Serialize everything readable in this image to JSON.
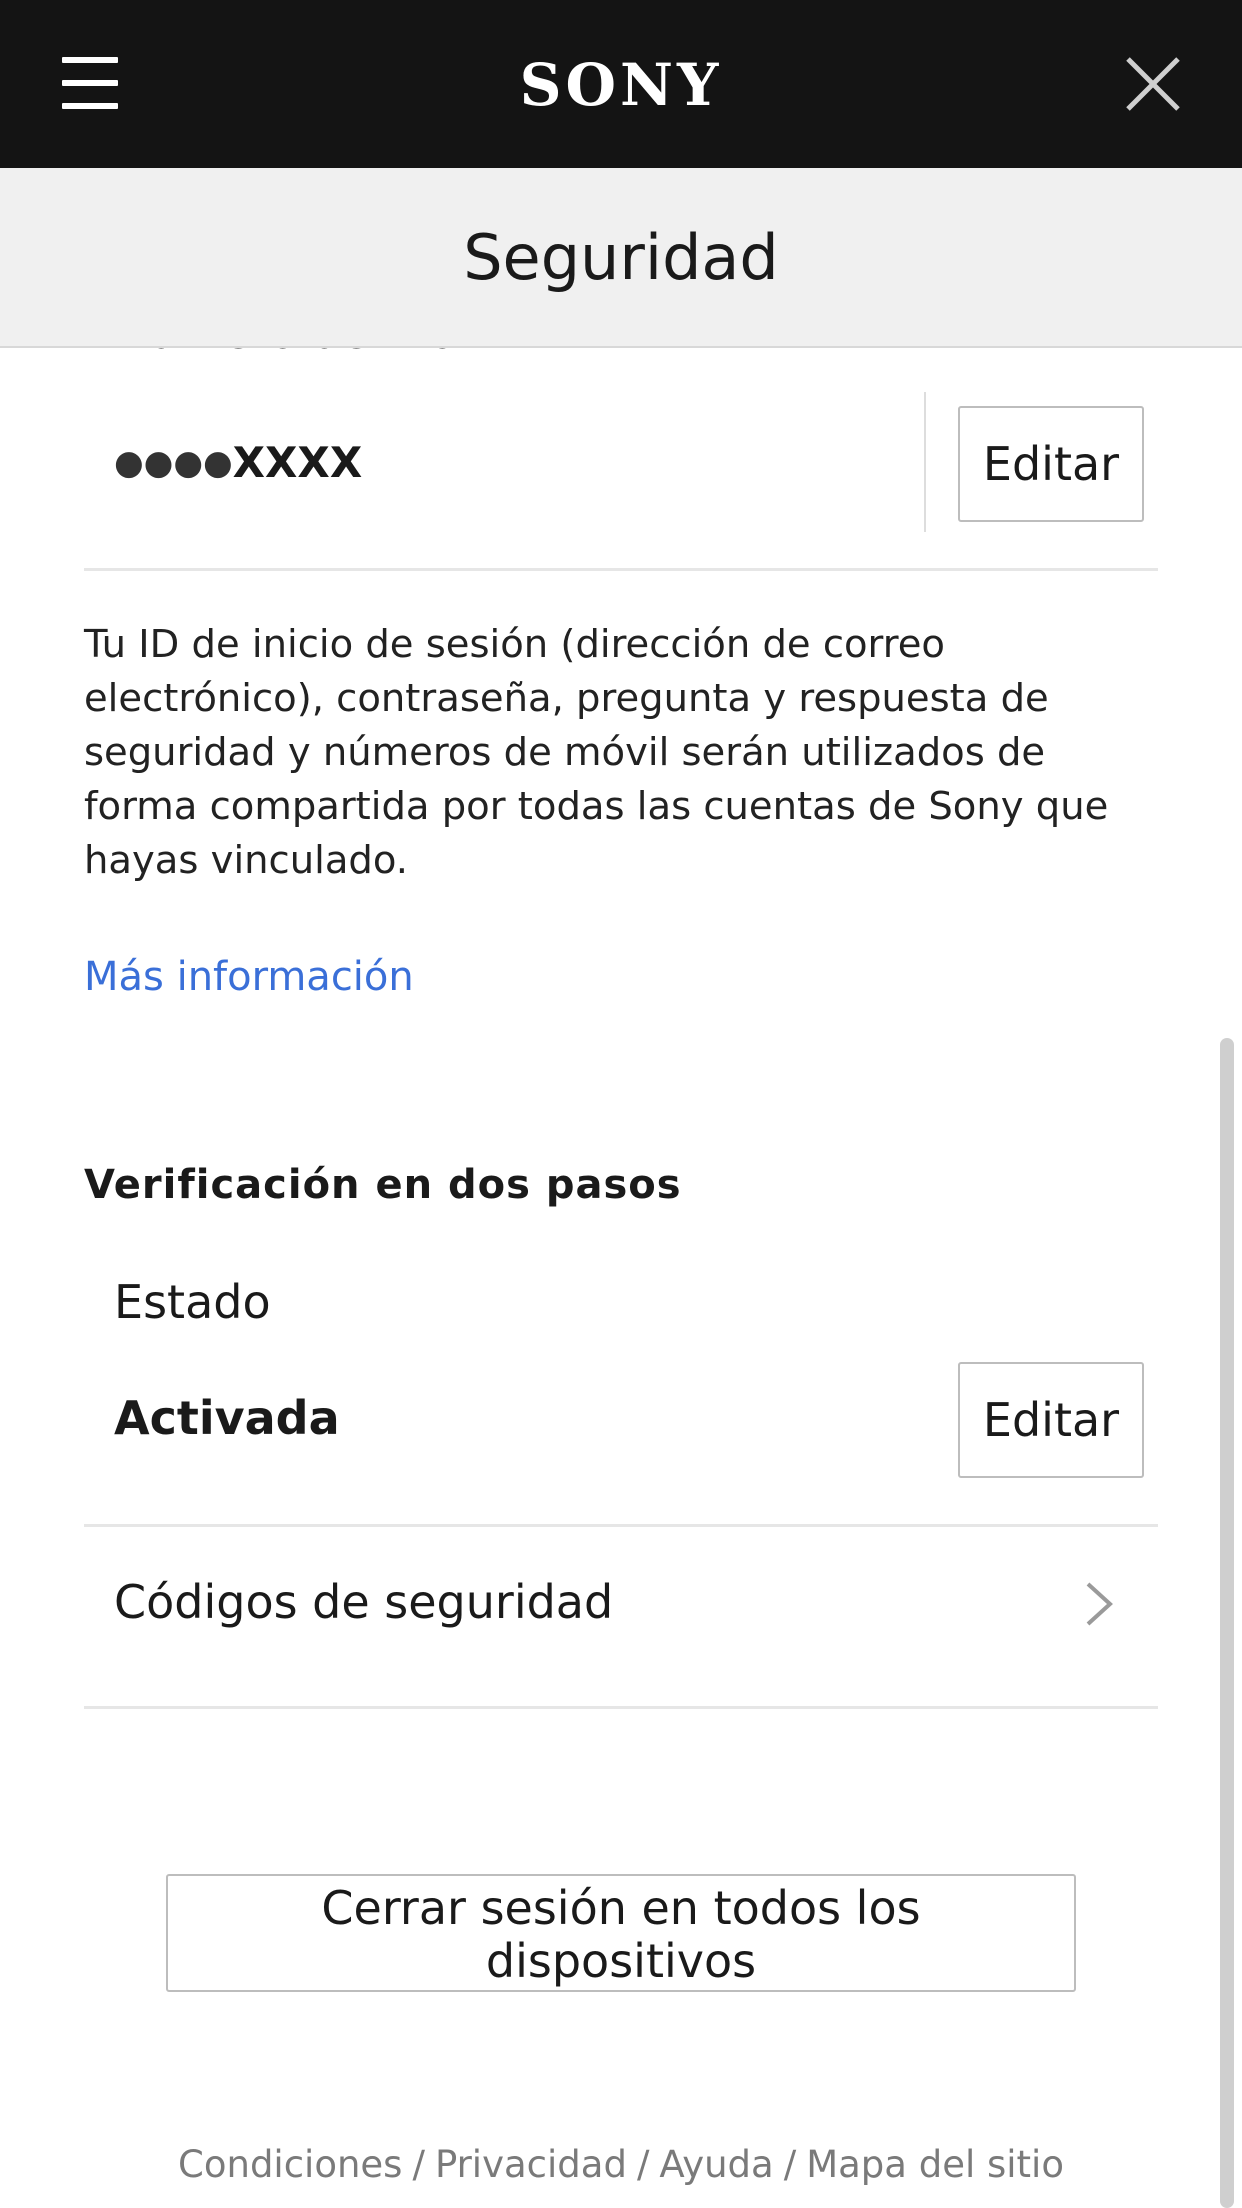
{
  "header": {
    "logo_text": "SONY",
    "menu_icon": "hamburger-menu-icon",
    "close_icon": "close-icon"
  },
  "page": {
    "title": "Seguridad"
  },
  "mobile": {
    "label": "Número de móvil",
    "masked_dots": "●●●●",
    "value_suffix": "XXXX",
    "edit_label": "Editar"
  },
  "info": {
    "text": "Tu ID de inicio de sesión (dirección de correo electrónico), contraseña, pregunta y respuesta de seguridad y números de móvil serán utilizados de forma compartida por todas las cuentas de Sony que hayas vinculado.",
    "more_link": "Más información"
  },
  "two_step": {
    "title": "Verificación en dos pasos",
    "status_label": "Estado",
    "status_value": "Activada",
    "edit_label": "Editar",
    "codes_label": "Códigos de seguridad",
    "codes_icon": "chevron-right-icon"
  },
  "actions": {
    "signout_all": "Cerrar sesión en todos los dispositivos"
  },
  "footer": {
    "links": [
      "Condiciones",
      "Privacidad",
      "Ayuda",
      "Mapa del sitio"
    ],
    "separator": "/"
  },
  "colors": {
    "topbar": "#141414",
    "subheader": "#f0f0f0",
    "link": "#3a6fd8",
    "footer_text": "#7a7a7a"
  }
}
